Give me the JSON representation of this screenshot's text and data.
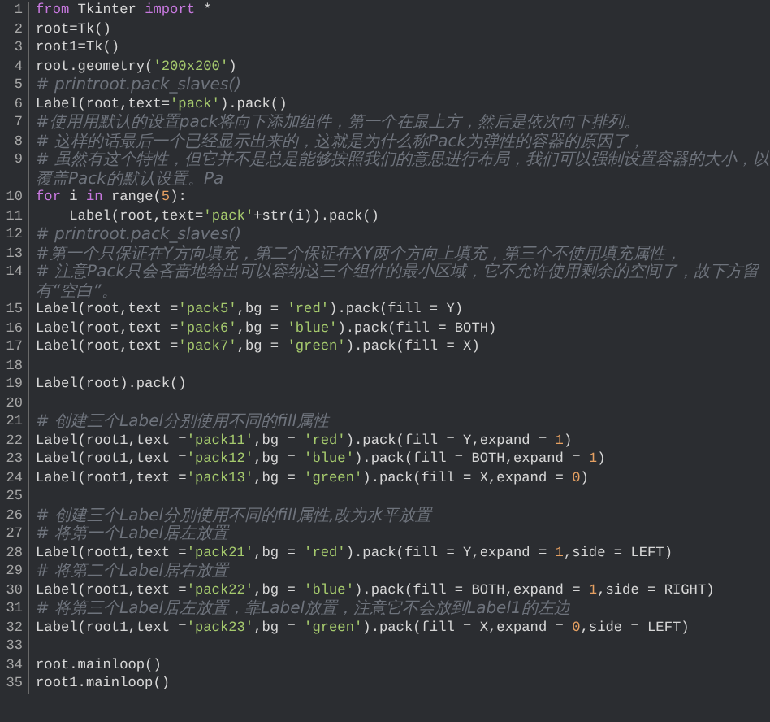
{
  "editor": {
    "lines": [
      {
        "number": "1",
        "tokens": [
          {
            "kind": "keyword",
            "text": "from"
          },
          {
            "kind": "plain",
            "text": " Tkinter "
          },
          {
            "kind": "keyword",
            "text": "import"
          },
          {
            "kind": "plain",
            "text": " *"
          }
        ]
      },
      {
        "number": "2",
        "tokens": [
          {
            "kind": "plain",
            "text": "root=Tk()"
          }
        ]
      },
      {
        "number": "3",
        "tokens": [
          {
            "kind": "plain",
            "text": "root1=Tk()"
          }
        ]
      },
      {
        "number": "4",
        "tokens": [
          {
            "kind": "plain",
            "text": "root.geometry("
          },
          {
            "kind": "string",
            "text": "'200x200'"
          },
          {
            "kind": "plain",
            "text": ")"
          }
        ]
      },
      {
        "number": "5",
        "tokens": [
          {
            "kind": "comment",
            "text": "# printroot.pack_slaves()"
          }
        ]
      },
      {
        "number": "6",
        "tokens": [
          {
            "kind": "plain",
            "text": "Label(root,text="
          },
          {
            "kind": "string",
            "text": "'pack'"
          },
          {
            "kind": "plain",
            "text": ").pack()"
          }
        ]
      },
      {
        "number": "7",
        "tokens": [
          {
            "kind": "comment",
            "text": "#使用用默认的设置pack将向下添加组件，第一个在最上方，然后是依次向下排列。"
          }
        ]
      },
      {
        "number": "8",
        "tokens": [
          {
            "kind": "comment",
            "text": "# 这样的话最后一个已经显示出来的，这就是为什么称Pack为弹性的容器的原因了，"
          }
        ]
      },
      {
        "number": "9",
        "tokens": [
          {
            "kind": "comment",
            "text": "# 虽然有这个特性，但它并不是总是能够按照我们的意思进行布局，我们可以强制设置容器的大小，以覆盖Pack的默认设置。Pa"
          }
        ]
      },
      {
        "number": "10",
        "tokens": [
          {
            "kind": "keyword",
            "text": "for"
          },
          {
            "kind": "plain",
            "text": " i "
          },
          {
            "kind": "keyword",
            "text": "in"
          },
          {
            "kind": "plain",
            "text": " range("
          },
          {
            "kind": "number",
            "text": "5"
          },
          {
            "kind": "plain",
            "text": "):"
          }
        ]
      },
      {
        "number": "11",
        "tokens": [
          {
            "kind": "plain",
            "text": "    Label(root,text="
          },
          {
            "kind": "string",
            "text": "'pack'"
          },
          {
            "kind": "plain",
            "text": "+str(i)).pack()"
          }
        ]
      },
      {
        "number": "12",
        "tokens": [
          {
            "kind": "comment",
            "text": "# printroot.pack_slaves()"
          }
        ]
      },
      {
        "number": "13",
        "tokens": [
          {
            "kind": "comment",
            "text": "#第一个只保证在Y方向填充，第二个保证在XY两个方向上填充，第三个不使用填充属性，"
          }
        ]
      },
      {
        "number": "14",
        "tokens": [
          {
            "kind": "comment",
            "text": "# 注意Pack只会吝啬地给出可以容纳这三个组件的最小区域，它不允许使用剩余的空间了，故下方留有“空白”。"
          }
        ]
      },
      {
        "number": "15",
        "tokens": [
          {
            "kind": "plain",
            "text": "Label(root,text ="
          },
          {
            "kind": "string",
            "text": "'pack5'"
          },
          {
            "kind": "plain",
            "text": ",bg = "
          },
          {
            "kind": "string",
            "text": "'red'"
          },
          {
            "kind": "plain",
            "text": ").pack(fill = Y)"
          }
        ]
      },
      {
        "number": "16",
        "tokens": [
          {
            "kind": "plain",
            "text": "Label(root,text ="
          },
          {
            "kind": "string",
            "text": "'pack6'"
          },
          {
            "kind": "plain",
            "text": ",bg = "
          },
          {
            "kind": "string",
            "text": "'blue'"
          },
          {
            "kind": "plain",
            "text": ").pack(fill = BOTH)"
          }
        ]
      },
      {
        "number": "17",
        "tokens": [
          {
            "kind": "plain",
            "text": "Label(root,text ="
          },
          {
            "kind": "string",
            "text": "'pack7'"
          },
          {
            "kind": "plain",
            "text": ",bg = "
          },
          {
            "kind": "string",
            "text": "'green'"
          },
          {
            "kind": "plain",
            "text": ").pack(fill = X)"
          }
        ]
      },
      {
        "number": "18"
      },
      {
        "number": "19",
        "tokens": [
          {
            "kind": "plain",
            "text": "Label(root).pack()"
          }
        ]
      },
      {
        "number": "20"
      },
      {
        "number": "21",
        "tokens": [
          {
            "kind": "comment",
            "text": "# 创建三个Label分别使用不同的fill属性"
          }
        ]
      },
      {
        "number": "22",
        "tokens": [
          {
            "kind": "plain",
            "text": "Label(root1,text ="
          },
          {
            "kind": "string",
            "text": "'pack11'"
          },
          {
            "kind": "plain",
            "text": ",bg = "
          },
          {
            "kind": "string",
            "text": "'red'"
          },
          {
            "kind": "plain",
            "text": ").pack(fill = Y,expand = "
          },
          {
            "kind": "number",
            "text": "1"
          },
          {
            "kind": "plain",
            "text": ")"
          }
        ]
      },
      {
        "number": "23",
        "tokens": [
          {
            "kind": "plain",
            "text": "Label(root1,text ="
          },
          {
            "kind": "string",
            "text": "'pack12'"
          },
          {
            "kind": "plain",
            "text": ",bg = "
          },
          {
            "kind": "string",
            "text": "'blue'"
          },
          {
            "kind": "plain",
            "text": ").pack(fill = BOTH,expand = "
          },
          {
            "kind": "number",
            "text": "1"
          },
          {
            "kind": "plain",
            "text": ")"
          }
        ]
      },
      {
        "number": "24",
        "tokens": [
          {
            "kind": "plain",
            "text": "Label(root1,text ="
          },
          {
            "kind": "string",
            "text": "'pack13'"
          },
          {
            "kind": "plain",
            "text": ",bg = "
          },
          {
            "kind": "string",
            "text": "'green'"
          },
          {
            "kind": "plain",
            "text": ").pack(fill = X,expand = "
          },
          {
            "kind": "number",
            "text": "0"
          },
          {
            "kind": "plain",
            "text": ")"
          }
        ]
      },
      {
        "number": "25"
      },
      {
        "number": "26",
        "tokens": [
          {
            "kind": "comment",
            "text": "# 创建三个Label分别使用不同的fill属性,改为水平放置"
          }
        ]
      },
      {
        "number": "27",
        "tokens": [
          {
            "kind": "comment",
            "text": "# 将第一个Label居左放置"
          }
        ]
      },
      {
        "number": "28",
        "tokens": [
          {
            "kind": "plain",
            "text": "Label(root1,text ="
          },
          {
            "kind": "string",
            "text": "'pack21'"
          },
          {
            "kind": "plain",
            "text": ",bg = "
          },
          {
            "kind": "string",
            "text": "'red'"
          },
          {
            "kind": "plain",
            "text": ").pack(fill = Y,expand = "
          },
          {
            "kind": "number",
            "text": "1"
          },
          {
            "kind": "plain",
            "text": ",side = LEFT)"
          }
        ]
      },
      {
        "number": "29",
        "tokens": [
          {
            "kind": "comment",
            "text": "# 将第二个Label居右放置"
          }
        ]
      },
      {
        "number": "30",
        "tokens": [
          {
            "kind": "plain",
            "text": "Label(root1,text ="
          },
          {
            "kind": "string",
            "text": "'pack22'"
          },
          {
            "kind": "plain",
            "text": ",bg = "
          },
          {
            "kind": "string",
            "text": "'blue'"
          },
          {
            "kind": "plain",
            "text": ").pack(fill = BOTH,expand = "
          },
          {
            "kind": "number",
            "text": "1"
          },
          {
            "kind": "plain",
            "text": ",side = RIGHT)"
          }
        ]
      },
      {
        "number": "31",
        "tokens": [
          {
            "kind": "comment",
            "text": "# 将第三个Label居左放置，靠Label放置，注意它不会放到Label1的左边"
          }
        ]
      },
      {
        "number": "32",
        "tokens": [
          {
            "kind": "plain",
            "text": "Label(root1,text ="
          },
          {
            "kind": "string",
            "text": "'pack23'"
          },
          {
            "kind": "plain",
            "text": ",bg = "
          },
          {
            "kind": "string",
            "text": "'green'"
          },
          {
            "kind": "plain",
            "text": ").pack(fill = X,expand = "
          },
          {
            "kind": "number",
            "text": "0"
          },
          {
            "kind": "plain",
            "text": ",side = LEFT)"
          }
        ]
      },
      {
        "number": "33"
      },
      {
        "number": "34",
        "tokens": [
          {
            "kind": "plain",
            "text": "root.mainloop()"
          }
        ]
      },
      {
        "number": "35",
        "tokens": [
          {
            "kind": "plain",
            "text": "root1.mainloop()"
          }
        ]
      }
    ]
  }
}
